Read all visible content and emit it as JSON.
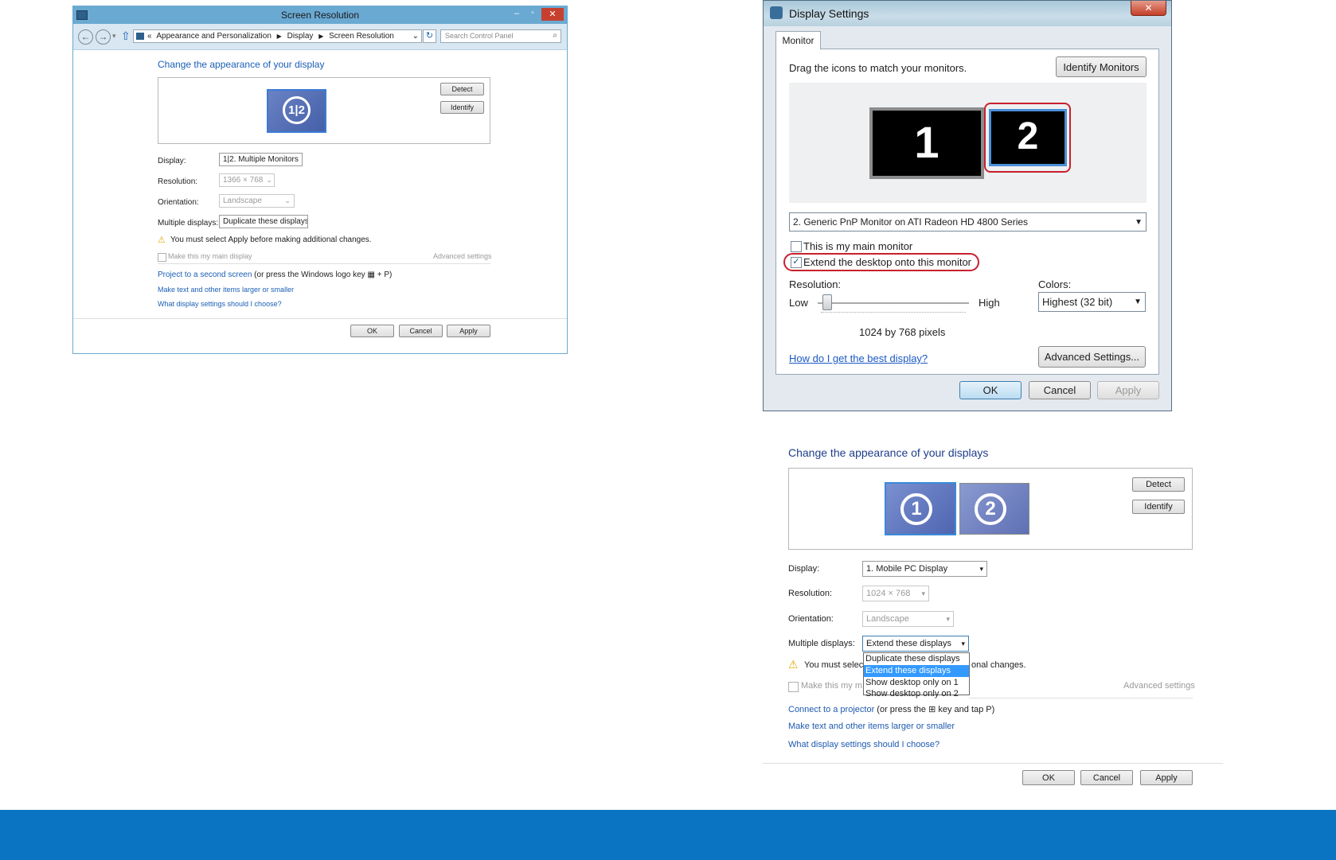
{
  "win8": {
    "title": "Screen Resolution",
    "breadcrumb": {
      "prefix": "«",
      "items": [
        "Appearance and Personalization",
        "Display",
        "Screen Resolution"
      ]
    },
    "search_placeholder": "Search Control Panel",
    "heading": "Change the appearance of your display",
    "monitor_label": "1|2",
    "detect": "Detect",
    "identify": "Identify",
    "fields": [
      {
        "label": "Display:",
        "value": "1|2. Multiple Monitors",
        "enabled": true
      },
      {
        "label": "Resolution:",
        "value": "1366 × 768",
        "enabled": false
      },
      {
        "label": "Orientation:",
        "value": "Landscape",
        "enabled": false
      },
      {
        "label": "Multiple displays:",
        "value": "Duplicate these displays",
        "enabled": true
      }
    ],
    "warning": "You must select Apply before making additional changes.",
    "main_display_checkbox": "Make this my main display",
    "advanced": "Advanced settings",
    "project_link": "Project to a second screen",
    "project_suffix": " (or press the Windows logo key ",
    "project_suffix2": " + P)",
    "link2": "Make text and other items larger or smaller",
    "link3": "What display settings should I choose?",
    "ok": "OK",
    "cancel": "Cancel",
    "apply": "Apply"
  },
  "vista": {
    "title": "Display Settings",
    "tab": "Monitor",
    "instruction": "Drag the icons to match your monitors.",
    "identify": "Identify Monitors",
    "monitor1": "1",
    "monitor2": "2",
    "monitor_select": "2. Generic PnP Monitor on ATI Radeon HD 4800 Series",
    "main_monitor": "This is my main monitor",
    "extend": "Extend the desktop onto this monitor",
    "extend_checked": true,
    "resolution_label": "Resolution:",
    "low": "Low",
    "high": "High",
    "resolution_value": "1024 by 768 pixels",
    "colors_label": "Colors:",
    "colors_value": "Highest (32 bit)",
    "help_link": "How do I get the best display?",
    "advanced": "Advanced Settings...",
    "ok": "OK",
    "cancel": "Cancel",
    "apply": "Apply",
    "highlight_color": "#c8202f"
  },
  "win7": {
    "heading": "Change the appearance of your displays",
    "monitor1": "1",
    "monitor2": "2",
    "detect": "Detect",
    "identify": "Identify",
    "fields": [
      {
        "label": "Display:",
        "value": "1. Mobile PC Display",
        "enabled": true
      },
      {
        "label": "Resolution:",
        "value": "1024 × 768",
        "enabled": false
      },
      {
        "label": "Orientation:",
        "value": "Landscape",
        "enabled": false
      },
      {
        "label": "Multiple displays:",
        "value": "Extend these displays",
        "enabled": true
      }
    ],
    "dropdown_options": [
      "Duplicate these displays",
      "Extend these displays",
      "Show desktop only on 1",
      "Show desktop only on 2"
    ],
    "dropdown_selected_index": 1,
    "warning_start": "You must selec",
    "warning_end": "onal changes.",
    "main_display_partial": "Make this my m",
    "advanced": "Advanced settings",
    "connect_link": "Connect to a projector",
    "connect_suffix": " (or press the ",
    "connect_suffix2": " key and tap P)",
    "link2": "Make text and other items larger or smaller",
    "link3": "What display settings should I choose?",
    "ok": "OK",
    "cancel": "Cancel",
    "apply": "Apply"
  },
  "colors": {
    "footer_bar": "#0a73c2",
    "win8_accent": "#6aa9d2",
    "link": "#1a5fb4"
  }
}
